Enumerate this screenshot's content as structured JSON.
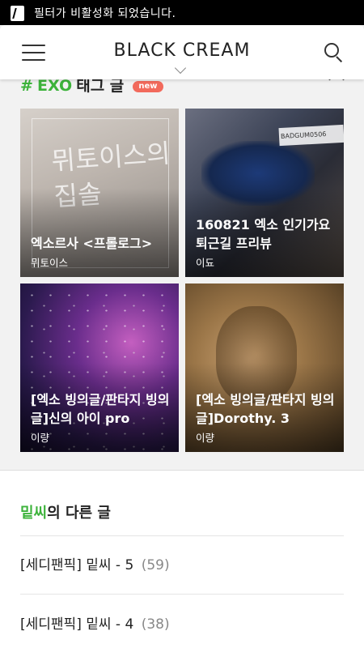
{
  "status_bar": {
    "notification": "필터가 비활성화 되었습니다."
  },
  "app_bar": {
    "brand": "BLACK CREAM"
  },
  "tag_section": {
    "hash": "#",
    "tag": "EXO",
    "title_suffix": "태그 글",
    "badge": "new"
  },
  "cards": [
    {
      "title": "엑소르사 <프롤로그>",
      "author": "뮈토이스",
      "image_text": "뮈토이스의 집솔"
    },
    {
      "title": "160821 엑소 인기가요 퇴근길 프리뷰",
      "author": "이됴",
      "image_text": "BADGUM0506"
    },
    {
      "title": "[엑소 빙의글/판타지 빙의글]신의 아이 pro",
      "author": "이량"
    },
    {
      "title": "[엑소 빙의글/판타지 빙의글]Dorothy. 3",
      "author": "이량"
    }
  ],
  "more_posts": {
    "nickname": "밑씨",
    "title_suffix": "의 다른 글",
    "items": [
      {
        "title": "[세디팬픽] 밑씨 - 5",
        "count": "(59)"
      },
      {
        "title": "[세디팬픽] 밑씨 - 4",
        "count": "(38)"
      }
    ]
  },
  "colors": {
    "accent": "#3db33b",
    "badge": "#f26a5c"
  },
  "icons": [
    "menu-icon",
    "search-icon",
    "chevron-down-icon",
    "chevron-up-icon",
    "notification-app-icon"
  ]
}
